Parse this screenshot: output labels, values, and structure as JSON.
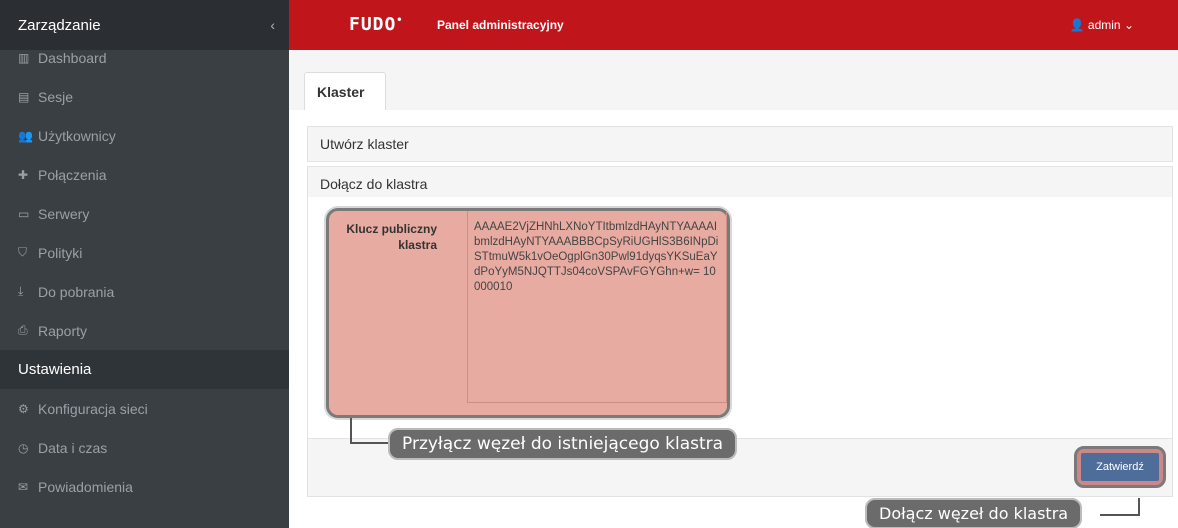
{
  "sidebar": {
    "title": "Zarządzanie",
    "collapse_glyph": "‹",
    "items": [
      {
        "label": "Dashboard",
        "icon": "dashboard-icon",
        "glyph": "▥"
      },
      {
        "label": "Sesje",
        "icon": "film-icon",
        "glyph": "▤"
      },
      {
        "label": "Użytkownicy",
        "icon": "users-icon",
        "glyph": "👥"
      },
      {
        "label": "Połączenia",
        "icon": "connections-icon",
        "glyph": "✚"
      },
      {
        "label": "Serwery",
        "icon": "server-icon",
        "glyph": "▭"
      },
      {
        "label": "Polityki",
        "icon": "shield-icon",
        "glyph": "⛉"
      },
      {
        "label": "Do pobrania",
        "icon": "download-icon",
        "glyph": "⤓"
      },
      {
        "label": "Raporty",
        "icon": "print-icon",
        "glyph": "⎙"
      }
    ],
    "section": "Ustawienia",
    "settings_items": [
      {
        "label": "Konfiguracja sieci",
        "icon": "cogs-icon",
        "glyph": "⚙"
      },
      {
        "label": "Data i czas",
        "icon": "clock-icon",
        "glyph": "◷"
      },
      {
        "label": "Powiadomienia",
        "icon": "envelope-icon",
        "glyph": "✉"
      }
    ]
  },
  "header": {
    "logo": "FUDO",
    "logo_mark": "•",
    "panel_title": "Panel administracyjny",
    "user": "admin",
    "user_glyph": "👤",
    "user_chevron": "⌄"
  },
  "tabs": [
    {
      "label": "Klaster"
    }
  ],
  "panels": {
    "create": "Utwórz klaster",
    "join": "Dołącz do klastra"
  },
  "form": {
    "key_label": "Klucz publiczny klastra",
    "key_value": "AAAAE2VjZHNhLXNoYTItbmlzdHAyNTYAAAAIbmlzdHAyNTYAAABBBCpSyRiUGHlS3B6INpDiSTtmuW5k1vOeOgplGn30Pwl91dyqsYKSuEaYdPoYyM5NJQTTJs04coVSPAvFGYGhn+w= 10000010",
    "submit": "Zatwierdź"
  },
  "callouts": {
    "attach": "Przyłącz węzeł do istniejącego klastra",
    "join": "Dołącz węzeł do klastra"
  },
  "colors": {
    "brand": "#c0151b",
    "sidebar": "#3a3f44",
    "highlight": "#e8aba2",
    "button": "#4f6d9a"
  }
}
